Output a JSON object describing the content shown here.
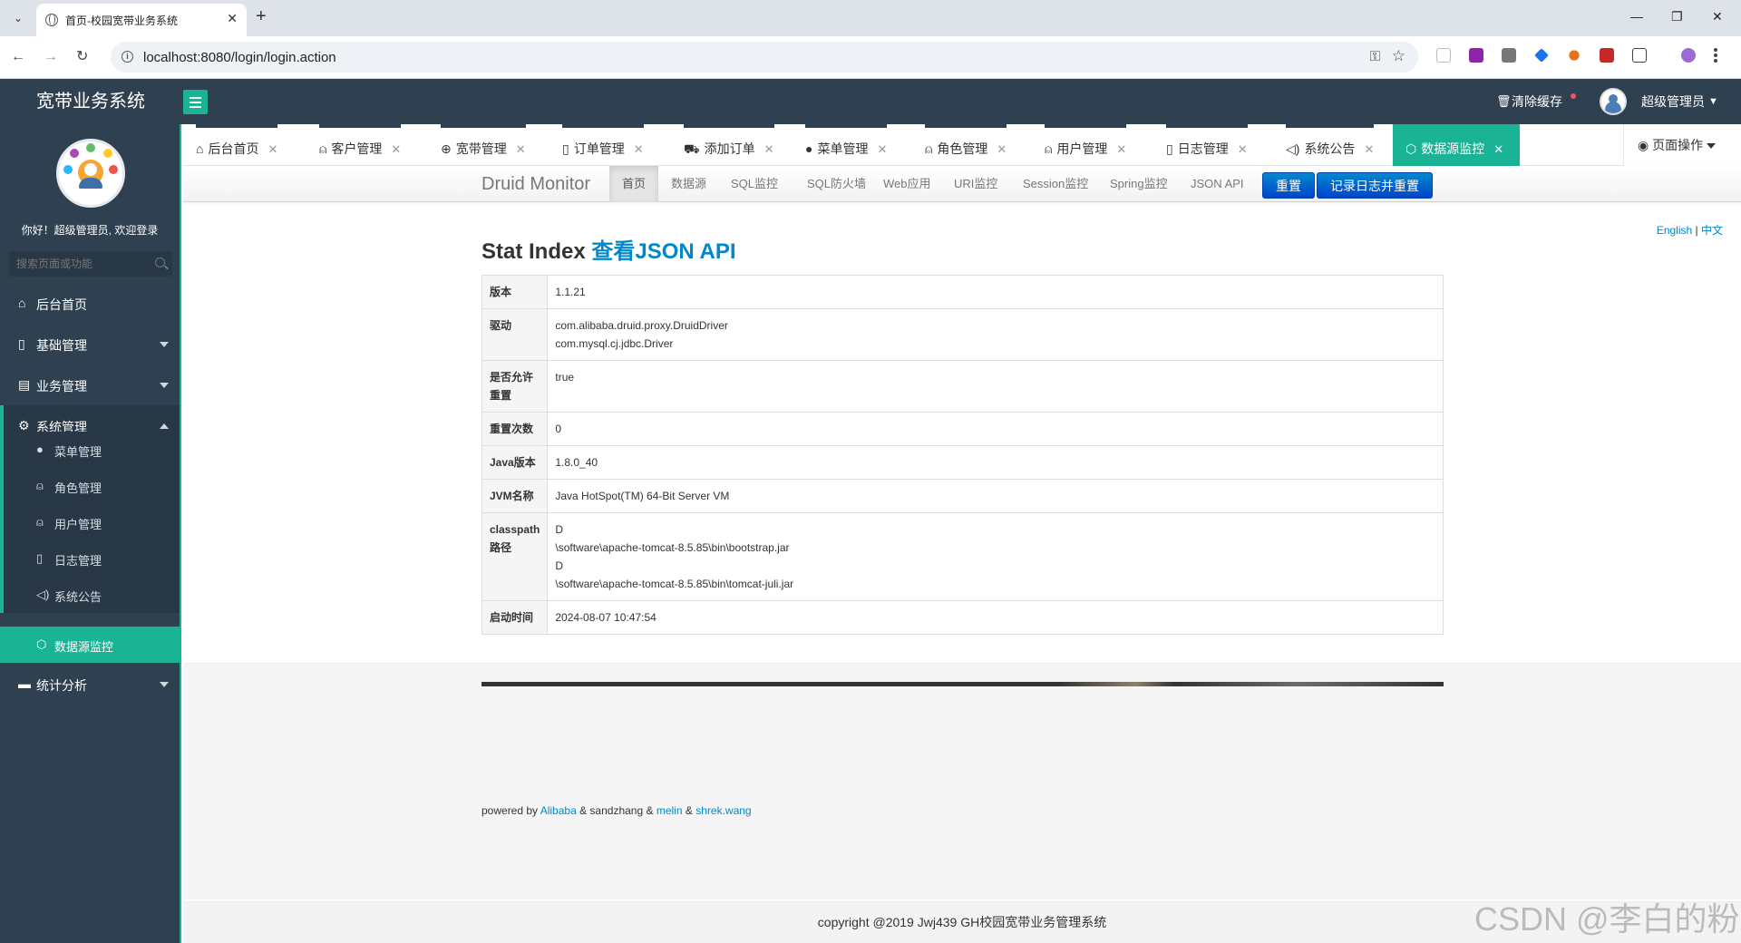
{
  "browser": {
    "tab_title": "首页-校园宽带业务系统",
    "url": "localhost:8080/login/login.action"
  },
  "header": {
    "app_name": "宽带业务系统",
    "clear_cache": "清除缓存",
    "user_name": "超级管理员"
  },
  "sidebar": {
    "welcome": "你好！超级管理员, 欢迎登录",
    "search_placeholder": "搜索页面或功能",
    "items": [
      {
        "label": "后台首页",
        "icon": "home-icon"
      },
      {
        "label": "基础管理",
        "icon": "file-icon"
      },
      {
        "label": "业务管理",
        "icon": "columns-icon"
      },
      {
        "label": "系统管理",
        "icon": "gear-icon"
      },
      {
        "label": "统计分析",
        "icon": "comment-icon"
      }
    ],
    "sub_items": [
      {
        "label": "菜单管理",
        "icon": "circle-icon"
      },
      {
        "label": "角色管理",
        "icon": "user-icon"
      },
      {
        "label": "用户管理",
        "icon": "user-outline-icon"
      },
      {
        "label": "日志管理",
        "icon": "file-icon"
      },
      {
        "label": "系统公告",
        "icon": "volume-icon"
      },
      {
        "label": "数据源监控",
        "icon": "cube-icon"
      }
    ]
  },
  "content_tabs": [
    {
      "label": "后台首页"
    },
    {
      "label": "客户管理"
    },
    {
      "label": "宽带管理"
    },
    {
      "label": "订单管理"
    },
    {
      "label": "添加订单"
    },
    {
      "label": "菜单管理"
    },
    {
      "label": "角色管理"
    },
    {
      "label": "用户管理"
    },
    {
      "label": "日志管理"
    },
    {
      "label": "系统公告"
    },
    {
      "label": "数据源监控"
    }
  ],
  "page_ops": "页面操作",
  "druid": {
    "brand": "Druid Monitor",
    "nav": [
      "首页",
      "数据源",
      "SQL监控",
      "SQL防火墙",
      "Web应用",
      "URI监控",
      "Session监控",
      "Spring监控",
      "JSON API"
    ],
    "reset_btn": "重置",
    "reset_log_btn": "记录日志并重置",
    "lang_en": "English",
    "lang_sep": "|",
    "lang_zh": "中文",
    "title": "Stat Index",
    "title_link": "查看JSON API",
    "rows": [
      {
        "key": "版本",
        "values": [
          "1.1.21"
        ]
      },
      {
        "key": "驱动",
        "values": [
          "com.alibaba.druid.proxy.DruidDriver",
          "com.mysql.cj.jdbc.Driver"
        ]
      },
      {
        "key": "是否允许重置",
        "values": [
          "true"
        ]
      },
      {
        "key": "重置次数",
        "values": [
          "0"
        ]
      },
      {
        "key": "Java版本",
        "values": [
          "1.8.0_40"
        ]
      },
      {
        "key": "JVM名称",
        "values": [
          "Java HotSpot(TM) 64-Bit Server VM"
        ]
      },
      {
        "key": "classpath路径",
        "values": [
          "D",
          "\\software\\apache-tomcat-8.5.85\\bin\\bootstrap.jar",
          "D",
          "\\software\\apache-tomcat-8.5.85\\bin\\tomcat-juli.jar"
        ]
      },
      {
        "key": "启动时间",
        "values": [
          "2024-08-07 10:47:54"
        ]
      }
    ],
    "powered": {
      "prefix": "powered by",
      "alibaba": "Alibaba",
      "amp1": "& sandzhang &",
      "melin": "melin",
      "amp2": "&",
      "shrek": "shrek.wang"
    }
  },
  "footer": "copyright @2019 Jwj439 GH校园宽带业务管理系统",
  "watermark": "CSDN @李白的粉"
}
